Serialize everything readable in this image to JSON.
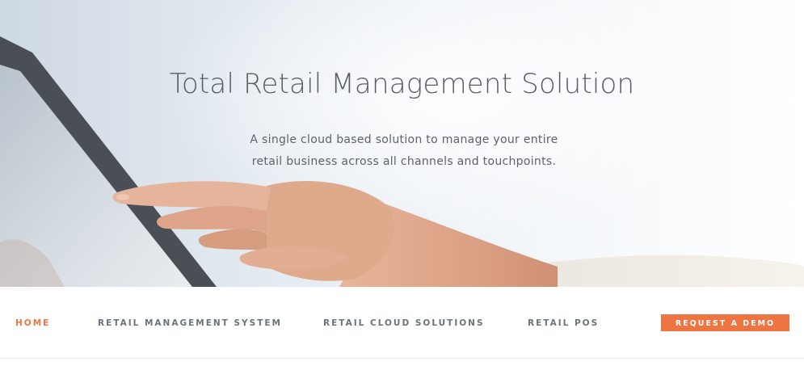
{
  "hero": {
    "title": "Total Retail Management Solution",
    "subtitle_lines": [
      "A single cloud based solution to manage your entire",
      "retail business across all channels and touchpoints."
    ]
  },
  "nav": {
    "items": [
      {
        "label": "HOME",
        "active": true
      },
      {
        "label": "RETAIL MANAGEMENT SYSTEM",
        "active": false
      },
      {
        "label": "RETAIL CLOUD SOLUTIONS",
        "active": false
      },
      {
        "label": "RETAIL POS",
        "active": false
      }
    ],
    "cta_label": "REQUEST A DEMO"
  },
  "colors": {
    "accent": "#ee7442",
    "nav_text": "#6c737a",
    "title_text": "#5a5f66"
  }
}
